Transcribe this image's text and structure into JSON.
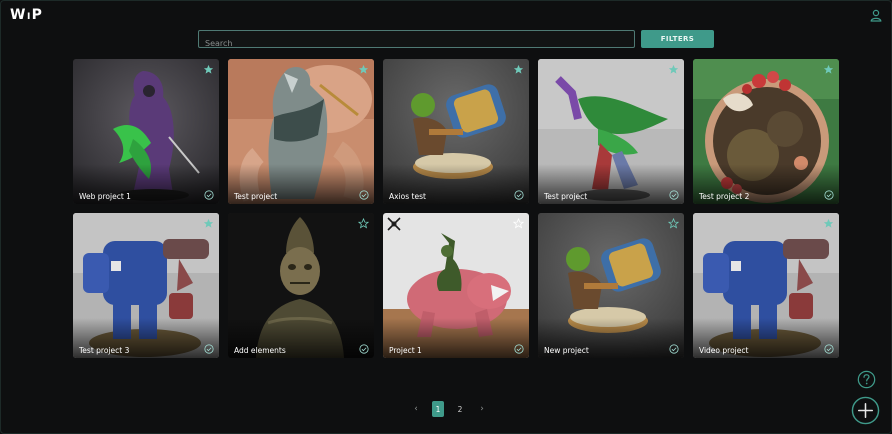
{
  "app": {
    "logo_left": "W",
    "logo_mid": "I",
    "logo_right": "P"
  },
  "search": {
    "placeholder": "Search",
    "value": ""
  },
  "filters": {
    "label": "FILTERS"
  },
  "accent_color": "#3f9a8a",
  "projects": [
    {
      "title": "Web project 1",
      "favorited": true,
      "completed": true
    },
    {
      "title": "Test project",
      "favorited": true,
      "completed": true
    },
    {
      "title": "Axios test",
      "favorited": true,
      "completed": true
    },
    {
      "title": "Test project",
      "favorited": true,
      "completed": true
    },
    {
      "title": "Test project 2",
      "favorited": true,
      "completed": true
    },
    {
      "title": "Test project 3",
      "favorited": true,
      "completed": true
    },
    {
      "title": "Add elements",
      "favorited": false,
      "completed": true
    },
    {
      "title": "Project 1",
      "favorited": false,
      "completed": true
    },
    {
      "title": "New project",
      "favorited": false,
      "completed": true
    },
    {
      "title": "Video project",
      "favorited": true,
      "completed": true
    }
  ],
  "pagination": {
    "prev": "‹",
    "pages": [
      "1",
      "2"
    ],
    "current": "1",
    "next": "›"
  },
  "icons": {
    "user": "user-icon",
    "star": "star-icon",
    "check": "check-circle-icon",
    "help": "help-icon",
    "add": "plus-icon",
    "tool": "crossed-tools-icon"
  }
}
